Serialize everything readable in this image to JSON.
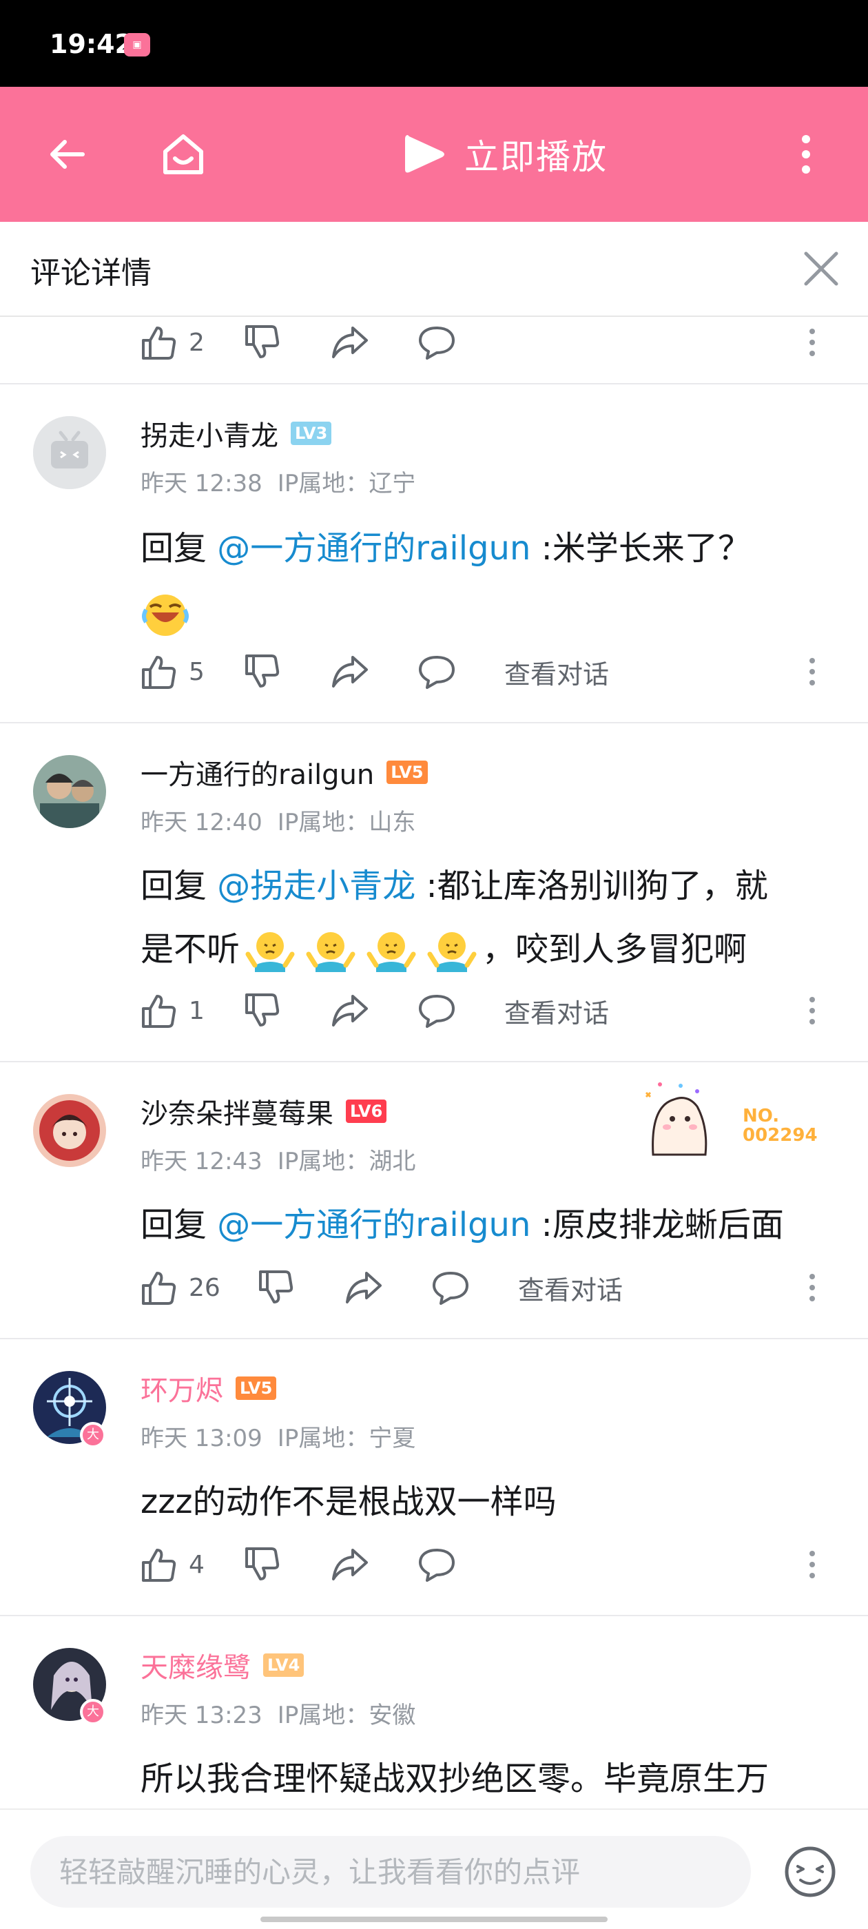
{
  "status_bar": {
    "time": "19:42"
  },
  "top_bar": {
    "play_label": "立即播放",
    "accent_color": "#fb7299"
  },
  "detail": {
    "title": "评论详情"
  },
  "top_partial": {
    "like_count": "2"
  },
  "comments": [
    {
      "username": "拐走小青龙",
      "level": "LV3",
      "time": "昨天 12:38",
      "ip": "IP属地：辽宁",
      "reply_prefix": "回复 ",
      "mention": "@一方通行的railgun",
      "text": " :米学长来了？",
      "like_count": "5",
      "view_conversation": "查看对话"
    },
    {
      "username": "一方通行的railgun",
      "level": "LV5",
      "time": "昨天 12:40",
      "ip": "IP属地：山东",
      "reply_prefix": "回复 ",
      "mention": "@拐走小青龙",
      "text_line1": " :都让库洛别训狗了，就",
      "text_line2a": "是不听",
      "text_line2b": "，咬到人多冒犯啊",
      "like_count": "1",
      "view_conversation": "查看对话"
    },
    {
      "username": "沙奈朵拌蔓莓果",
      "level": "LV6",
      "time": "昨天 12:43",
      "ip": "IP属地：湖北",
      "reply_prefix": "回复 ",
      "mention": "@一方通行的railgun",
      "text": " :原皮排龙蜥后面",
      "like_count": "26",
      "view_conversation": "查看对话",
      "decoration_no": "NO.",
      "decoration_num": "002294"
    },
    {
      "username": "环万烬",
      "level": "LV5",
      "time": "昨天 13:09",
      "ip": "IP属地：宁夏",
      "text": "zzz的动作不是根战双一样吗",
      "like_count": "4",
      "vip_badge": "大"
    },
    {
      "username": "天糜缘鹭",
      "level": "LV4",
      "time": "昨天 13:23",
      "ip": "IP属地：安徽",
      "text": "所以我合理怀疑战双抄绝区零。毕竟原生万",
      "vip_badge": "大"
    }
  ],
  "input": {
    "placeholder": "轻轻敲醒沉睡的心灵，让我看看你的点评"
  }
}
